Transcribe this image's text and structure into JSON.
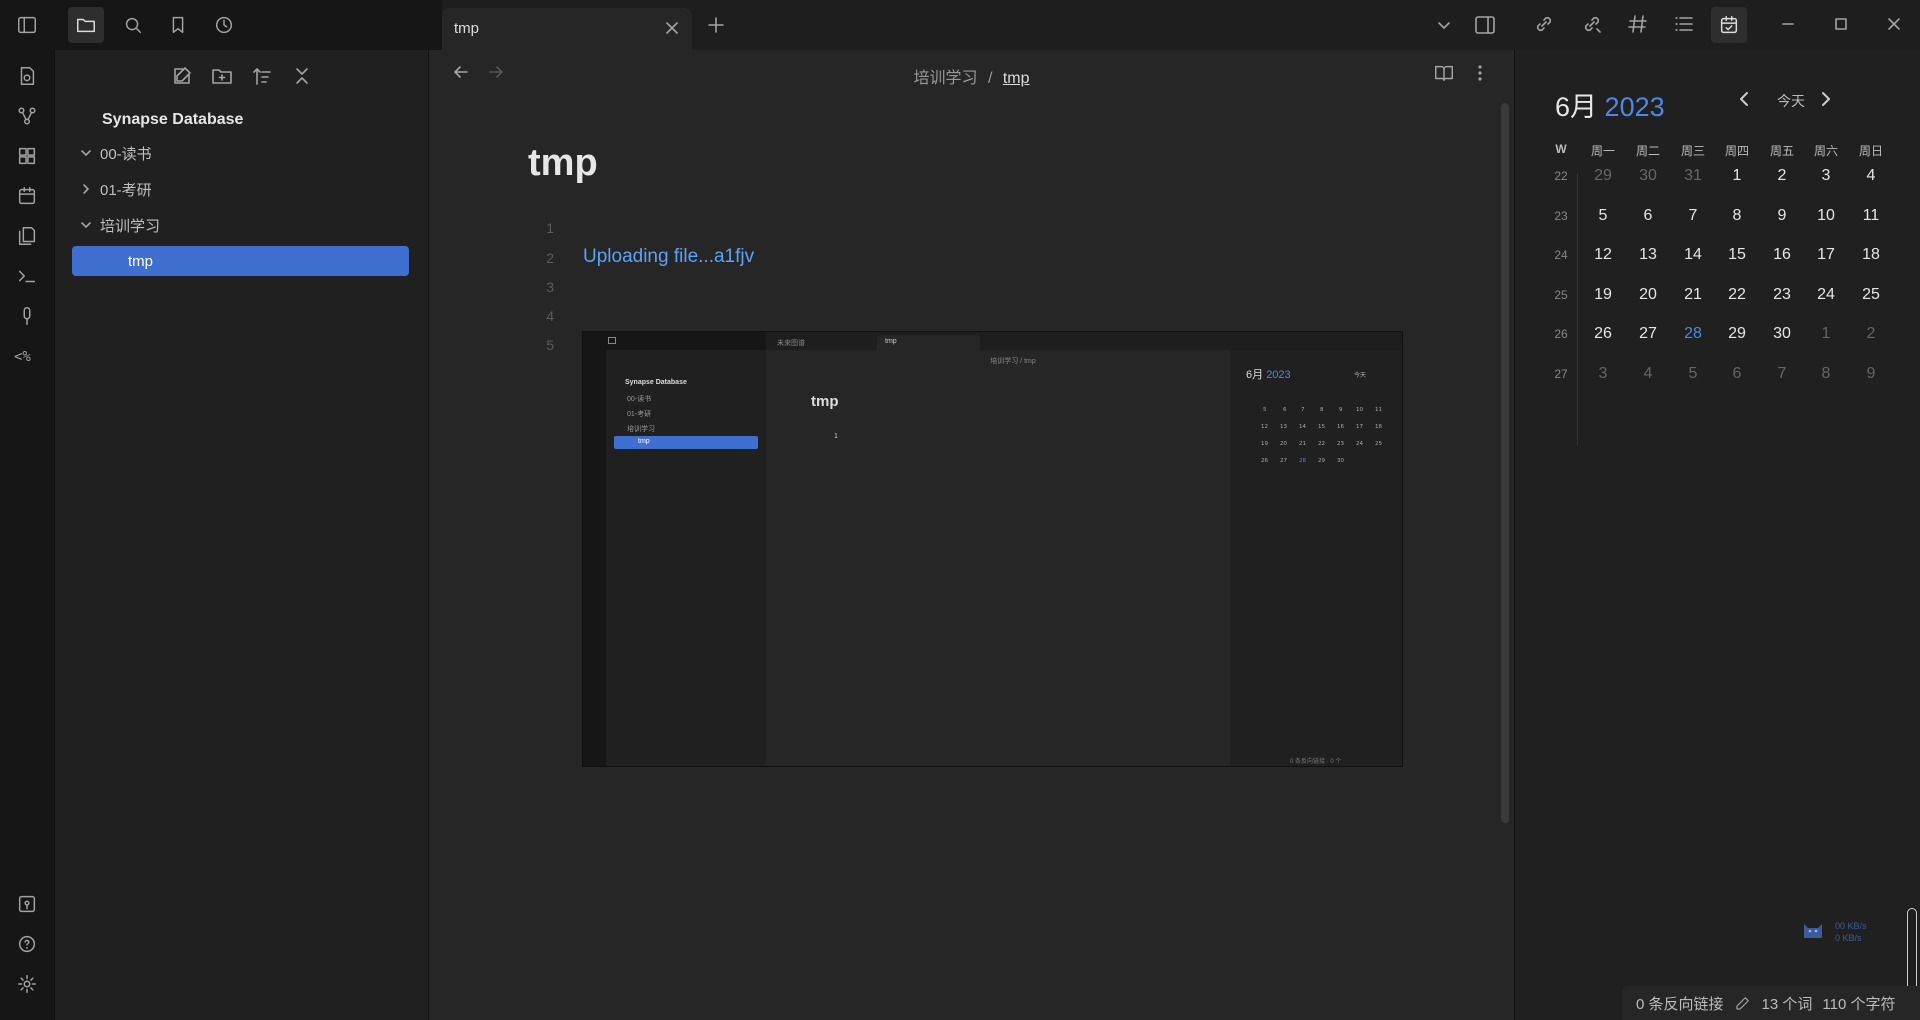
{
  "topbar": {
    "tab_title": "tmp",
    "new_tab": "+"
  },
  "explorer": {
    "vault_name": "Synapse Database",
    "items": [
      {
        "label": "00-读书",
        "expanded": true
      },
      {
        "label": "01-考研",
        "expanded": false
      },
      {
        "label": "培训学习",
        "expanded": true
      },
      {
        "label": "tmp",
        "active": true
      }
    ]
  },
  "editor": {
    "breadcrumb_parent": "培训学习",
    "breadcrumb_sep": "/",
    "breadcrumb_current": "tmp",
    "title": "tmp",
    "line_numbers": [
      "1",
      "2",
      "3",
      "4",
      "5"
    ],
    "uploading_text": "Uploading file...a1fjv"
  },
  "embedded_screenshot": {
    "tab1": "未来图谱",
    "tab2": "tmp",
    "breadcrumb": "培训学习 / tmp",
    "vault_name": "Synapse Database",
    "items": [
      "00-读书",
      "01-考研",
      "培训学习",
      "tmp"
    ],
    "title": "tmp",
    "cursor_text": "1",
    "month": "6月",
    "year": "2023",
    "today": "今天",
    "status": "0 条反向链接 · 0 个词 1 个字符"
  },
  "calendar": {
    "month": "6月",
    "year": "2023",
    "today_label": "今天",
    "week_header": "W",
    "weekdays": [
      "周一",
      "周二",
      "周三",
      "周四",
      "周五",
      "周六",
      "周日"
    ],
    "weeks": [
      {
        "week": "22",
        "days": [
          "29",
          "30",
          "31",
          "1",
          "2",
          "3",
          "4"
        ],
        "dim": [
          true,
          true,
          true,
          false,
          false,
          false,
          false
        ]
      },
      {
        "week": "23",
        "days": [
          "5",
          "6",
          "7",
          "8",
          "9",
          "10",
          "11"
        ],
        "dim": [
          false,
          false,
          false,
          false,
          false,
          false,
          false
        ]
      },
      {
        "week": "24",
        "days": [
          "12",
          "13",
          "14",
          "15",
          "16",
          "17",
          "18"
        ],
        "dim": [
          false,
          false,
          false,
          false,
          false,
          false,
          false
        ]
      },
      {
        "week": "25",
        "days": [
          "19",
          "20",
          "21",
          "22",
          "23",
          "24",
          "25"
        ],
        "dim": [
          false,
          false,
          false,
          false,
          false,
          false,
          false
        ]
      },
      {
        "week": "26",
        "days": [
          "26",
          "27",
          "28",
          "29",
          "30",
          "1",
          "2"
        ],
        "dim": [
          false,
          false,
          false,
          false,
          false,
          true,
          true
        ]
      },
      {
        "week": "27",
        "days": [
          "3",
          "4",
          "5",
          "6",
          "7",
          "8",
          "9"
        ],
        "dim": [
          true,
          true,
          true,
          true,
          true,
          true,
          true
        ]
      }
    ],
    "today_day": "28"
  },
  "statusbar": {
    "backlinks": "0 条反向链接",
    "words": "13 个词",
    "chars": "110 个字符"
  },
  "net_widget": {
    "up": "00 KB/s",
    "down": "0 KB/s"
  }
}
